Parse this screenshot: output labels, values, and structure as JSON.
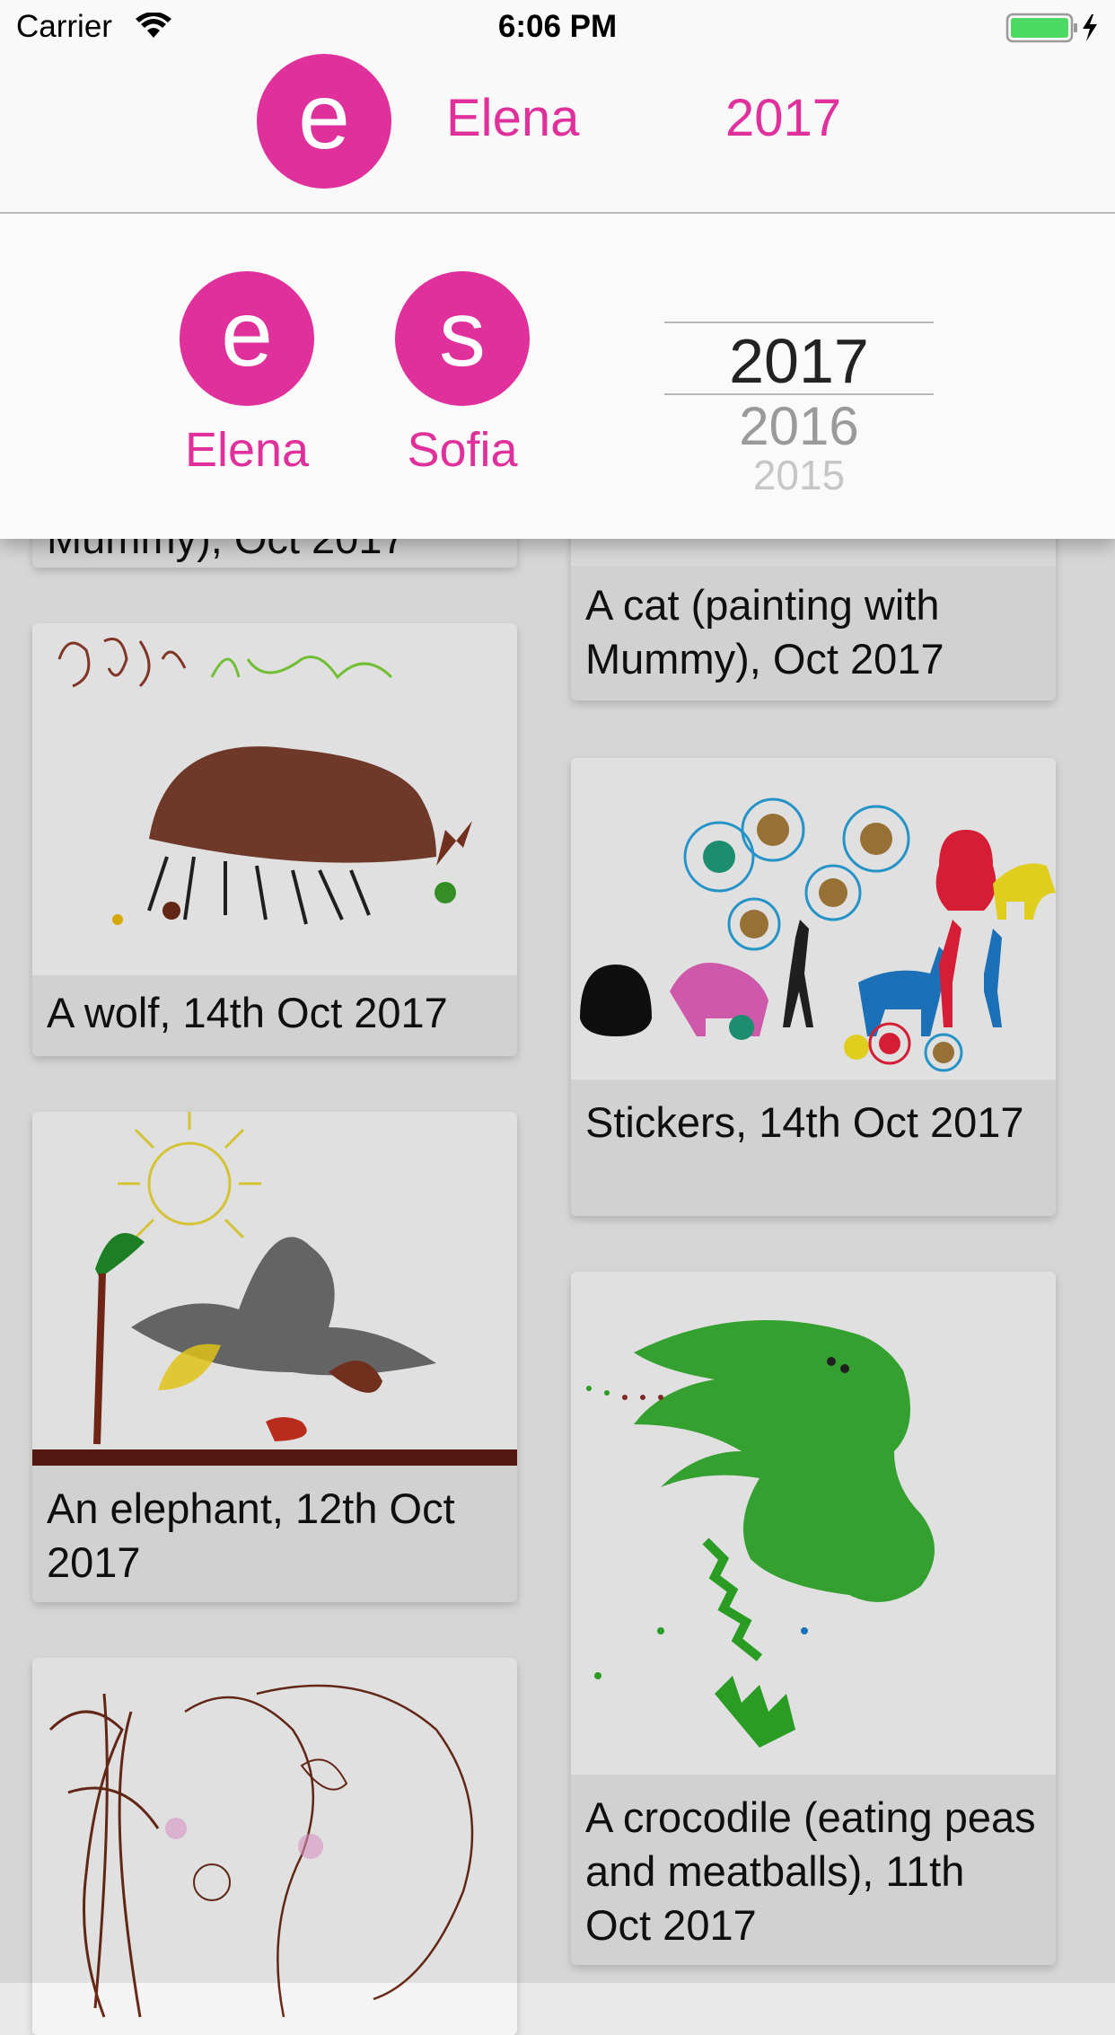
{
  "status_bar": {
    "carrier": "Carrier",
    "time": "6:06 PM",
    "battery_color": "#4cd964"
  },
  "header": {
    "avatar_letter": "e",
    "name": "Elena",
    "year": "2017",
    "accent": "#e0309b"
  },
  "selector": {
    "children": [
      {
        "letter": "e",
        "name": "Elena"
      },
      {
        "letter": "s",
        "name": "Sofia"
      }
    ],
    "years": [
      "2017",
      "2016",
      "2015"
    ],
    "selected_year": "2017"
  },
  "gallery": {
    "left_column": [
      {
        "caption": "Mummy), Oct 2017"
      },
      {
        "caption": "A wolf, 14th Oct 2017"
      },
      {
        "caption": "An elephant, 12th Oct 2017"
      },
      {
        "caption": ""
      }
    ],
    "right_column": [
      {
        "caption": "A cat (painting with Mummy), Oct 2017"
      },
      {
        "caption": "Stickers, 14th Oct 2017"
      },
      {
        "caption": "A crocodile (eating peas and meatballs), 11th Oct 2017"
      }
    ]
  }
}
